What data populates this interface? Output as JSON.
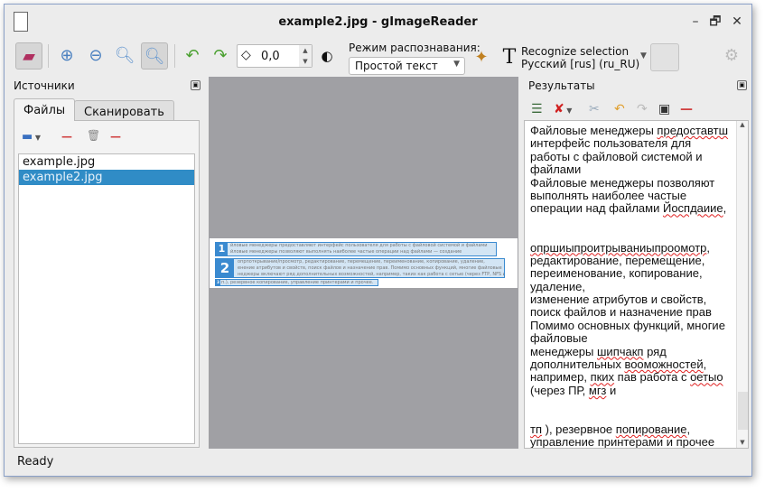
{
  "window": {
    "title": "example2.jpg - gImageReader",
    "minimize": "–",
    "restore": "🗗",
    "close": "✕"
  },
  "toolbar": {
    "rotation_value": "0,0",
    "mode_label": "Режим распознавания:",
    "mode_value": "Простой текст",
    "recognize_line1": "Recognize selection",
    "recognize_line2": "Русский [rus] (ru_RU)",
    "icons": [
      "image-source-icon",
      "zoom-in-icon",
      "zoom-out-icon",
      "zoom-original-icon",
      "zoom-fit-icon",
      "rotate-left-icon",
      "rotate-right-icon",
      "rotate-angle-icon",
      "image-controls-icon",
      "autolayout-icon",
      "recognize-icon",
      "settings-icon"
    ]
  },
  "sources": {
    "title": "Источники",
    "tabs": [
      "Файлы",
      "Сканировать"
    ],
    "active_tab": "Файлы",
    "files": [
      "example.jpg",
      "example2.jpg"
    ],
    "selected_file": "example2.jpg"
  },
  "canvas": {
    "regions": [
      {
        "number": "1",
        "lines": [
          "йловые менеджеры предоставляют интерфейс пользователя для работы с файловой системой и файлами",
          "йловые менеджеры позволяют выполнять наиболее частые операции над файлами — создание"
        ]
      },
      {
        "number": "2",
        "lines": [
          "опрпоткрывание/просмотр, редактирование, перемещение, переименование, копирование, удаление,",
          "енение атрибутов и свойств, поиск файлов и назначение прав. Помимо основных функций, многие файловые",
          "неджеры включают ряд дополнительных возможностей, например, таких как работа с сетью (через FTP, NFS и"
        ]
      },
      {
        "number": "3",
        "lines": [
          "п.), резервное копирование, управление принтерами и прочее."
        ]
      }
    ]
  },
  "results": {
    "title": "Результаты",
    "lines": [
      "Файловые менеджеры предоставтш",
      "интерфейс пользователя для",
      "работы с файловой системой и",
      "файлами",
      "Файловые менеджеры позволяют",
      "выполнять наиболее частые",
      "операции над файлами Йоспдаиие,",
      "",
      "",
      "опршиыпроитрываниыпроомотр,",
      "редактирование, перемещение,",
      "переименование, копирование,",
      "удаление,",
      "изменение атрибутов и свойств,",
      "поиск файлов и назначение прав",
      "Помимо основных функций, многие",
      "файловые",
      "менеджеры шипчакп ряд",
      "дополнительных воомож­ностей,",
      "например, пких пав работа с оетыо",
      "(через ПР, мгз и",
      "",
      "",
      "тп ), резервное попирование,",
      "управление принтерами и прочее"
    ],
    "misspelled": [
      "предоставтш",
      "Йоспдаиие",
      "опршиыпроитрываниыпроомотр",
      "шипчакп",
      "воомож­ностей",
      "пких",
      "оетыо",
      "мгз",
      "тп",
      "попирование"
    ]
  },
  "status": "Ready",
  "colors": {
    "selection": "#308cc6",
    "region": "#3a8ad0",
    "canvas": "#a0a0a4"
  }
}
